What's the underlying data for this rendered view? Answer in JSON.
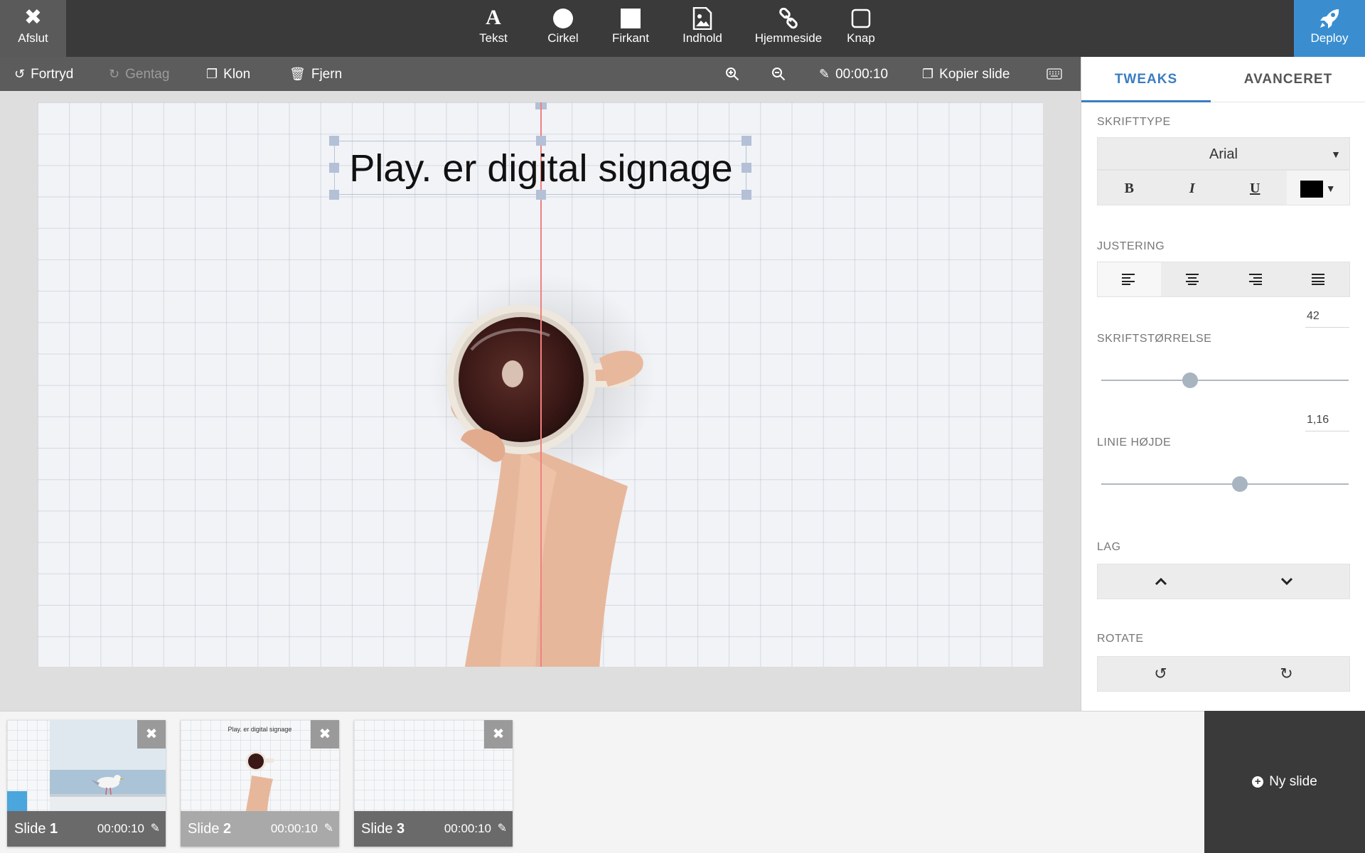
{
  "topbar": {
    "exit_label": "Afslut",
    "tools": [
      {
        "label": "Tekst",
        "icon": "text-icon"
      },
      {
        "label": "Cirkel",
        "icon": "circle-icon"
      },
      {
        "label": "Firkant",
        "icon": "square-icon"
      },
      {
        "label": "Indhold",
        "icon": "image-file-icon"
      },
      {
        "label": "Hjemmeside",
        "icon": "link-icon"
      },
      {
        "label": "Knap",
        "icon": "button-icon"
      }
    ],
    "deploy_label": "Deploy"
  },
  "subbar": {
    "undo_label": "Fortryd",
    "redo_label": "Gentag",
    "clone_label": "Klon",
    "remove_label": "Fjern",
    "duration": "00:00:10",
    "copy_slide_label": "Kopier slide"
  },
  "canvas": {
    "text_element": "Play. er digital signage"
  },
  "panel": {
    "tabs": [
      "TWEAKS",
      "AVANCERET"
    ],
    "font_label": "SKRIFTTYPE",
    "font_value": "Arial",
    "color_value": "#000000",
    "align_label": "JUSTERING",
    "font_size_label": "SKRIFTSTØRRELSE",
    "font_size_value": "42",
    "font_size_slider": 0.36,
    "line_height_label": "LINIE HØJDE",
    "line_height_value": "1,16",
    "line_height_slider": 0.56,
    "layer_label": "LAG",
    "rotate_label": "ROTATE"
  },
  "slides": [
    {
      "name": "Slide",
      "number": "1",
      "time": "00:00:10"
    },
    {
      "name": "Slide",
      "number": "2",
      "time": "00:00:10",
      "thumb_text": "Play. er digital signage"
    },
    {
      "name": "Slide",
      "number": "3",
      "time": "00:00:10"
    }
  ],
  "new_slide_label": "Ny slide"
}
